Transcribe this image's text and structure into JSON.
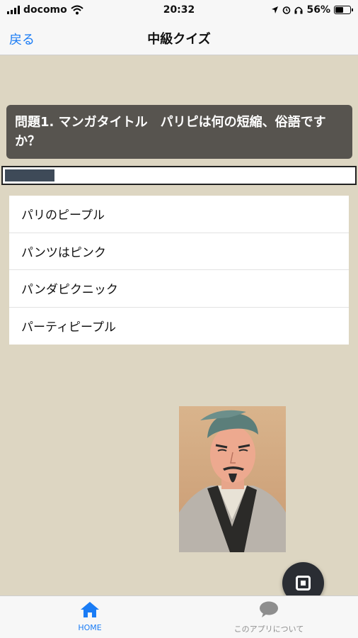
{
  "status_bar": {
    "carrier": "docomo",
    "time": "20:32",
    "battery_percent": "56%",
    "battery_level": 0.56,
    "icons": [
      "signal-icon",
      "wifi-icon",
      "location-icon",
      "alarm-icon",
      "headphones-icon",
      "battery-icon"
    ]
  },
  "navbar": {
    "back_label": "戻る",
    "title": "中級クイズ"
  },
  "question": {
    "text": "問題1. マンガタイトル　パリピは何の短縮、俗語ですか？"
  },
  "progress": {
    "value": 0.14
  },
  "answers": [
    "パリのピープル",
    "パンツはピンク",
    "パンダピクニック",
    "パーティピープル"
  ],
  "image": {
    "icon": "portrait-image"
  },
  "fab": {
    "icon": "stop-icon"
  },
  "tabbar": {
    "home_label": "HOME",
    "about_label": "このアプリについて",
    "accent_color": "#1a7cf5",
    "inactive_color": "#8e8e8e"
  }
}
